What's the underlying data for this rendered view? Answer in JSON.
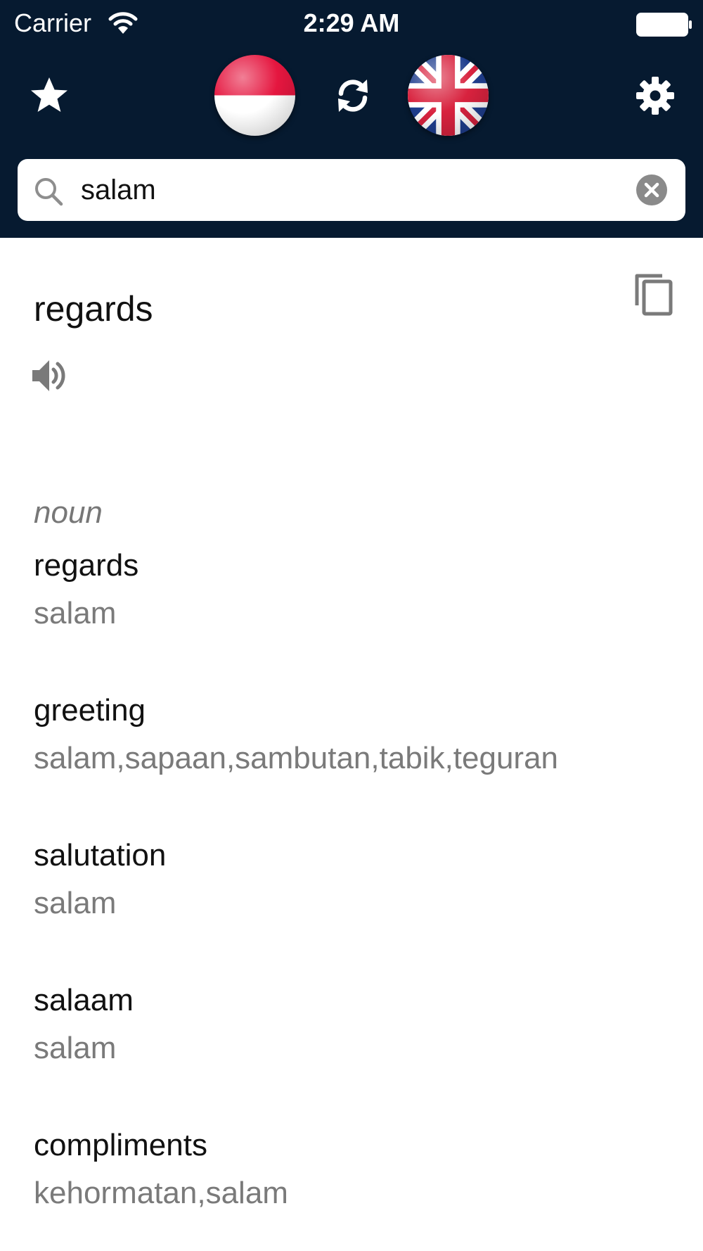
{
  "status_bar": {
    "carrier": "Carrier",
    "time": "2:29 AM",
    "wifi_icon": "wifi-icon",
    "battery_icon": "battery-icon"
  },
  "toolbar": {
    "favorites_icon": "star-icon",
    "source_language_flag": "flag-indonesia",
    "swap_icon": "refresh-icon",
    "target_language_flag": "flag-united-kingdom",
    "settings_icon": "gear-icon"
  },
  "search": {
    "value": "salam",
    "search_icon": "search-icon",
    "clear_icon": "close-circle-icon"
  },
  "result": {
    "headword": "regards",
    "copy_icon": "copy-icon",
    "speaker_icon": "speaker-icon",
    "part_of_speech": "noun",
    "entries": [
      {
        "word": "regards",
        "translations": "salam"
      },
      {
        "word": "greeting",
        "translations": "salam,sapaan,sambutan,tabik,teguran"
      },
      {
        "word": "salutation",
        "translations": "salam"
      },
      {
        "word": "salaam",
        "translations": "salam"
      },
      {
        "word": "compliments",
        "translations": "kehormatan,salam"
      }
    ]
  },
  "colors": {
    "header_bg": "#061a30",
    "text_primary": "#111111",
    "text_secondary": "#7a7a7a",
    "icon_gray": "#7a7a7a"
  }
}
